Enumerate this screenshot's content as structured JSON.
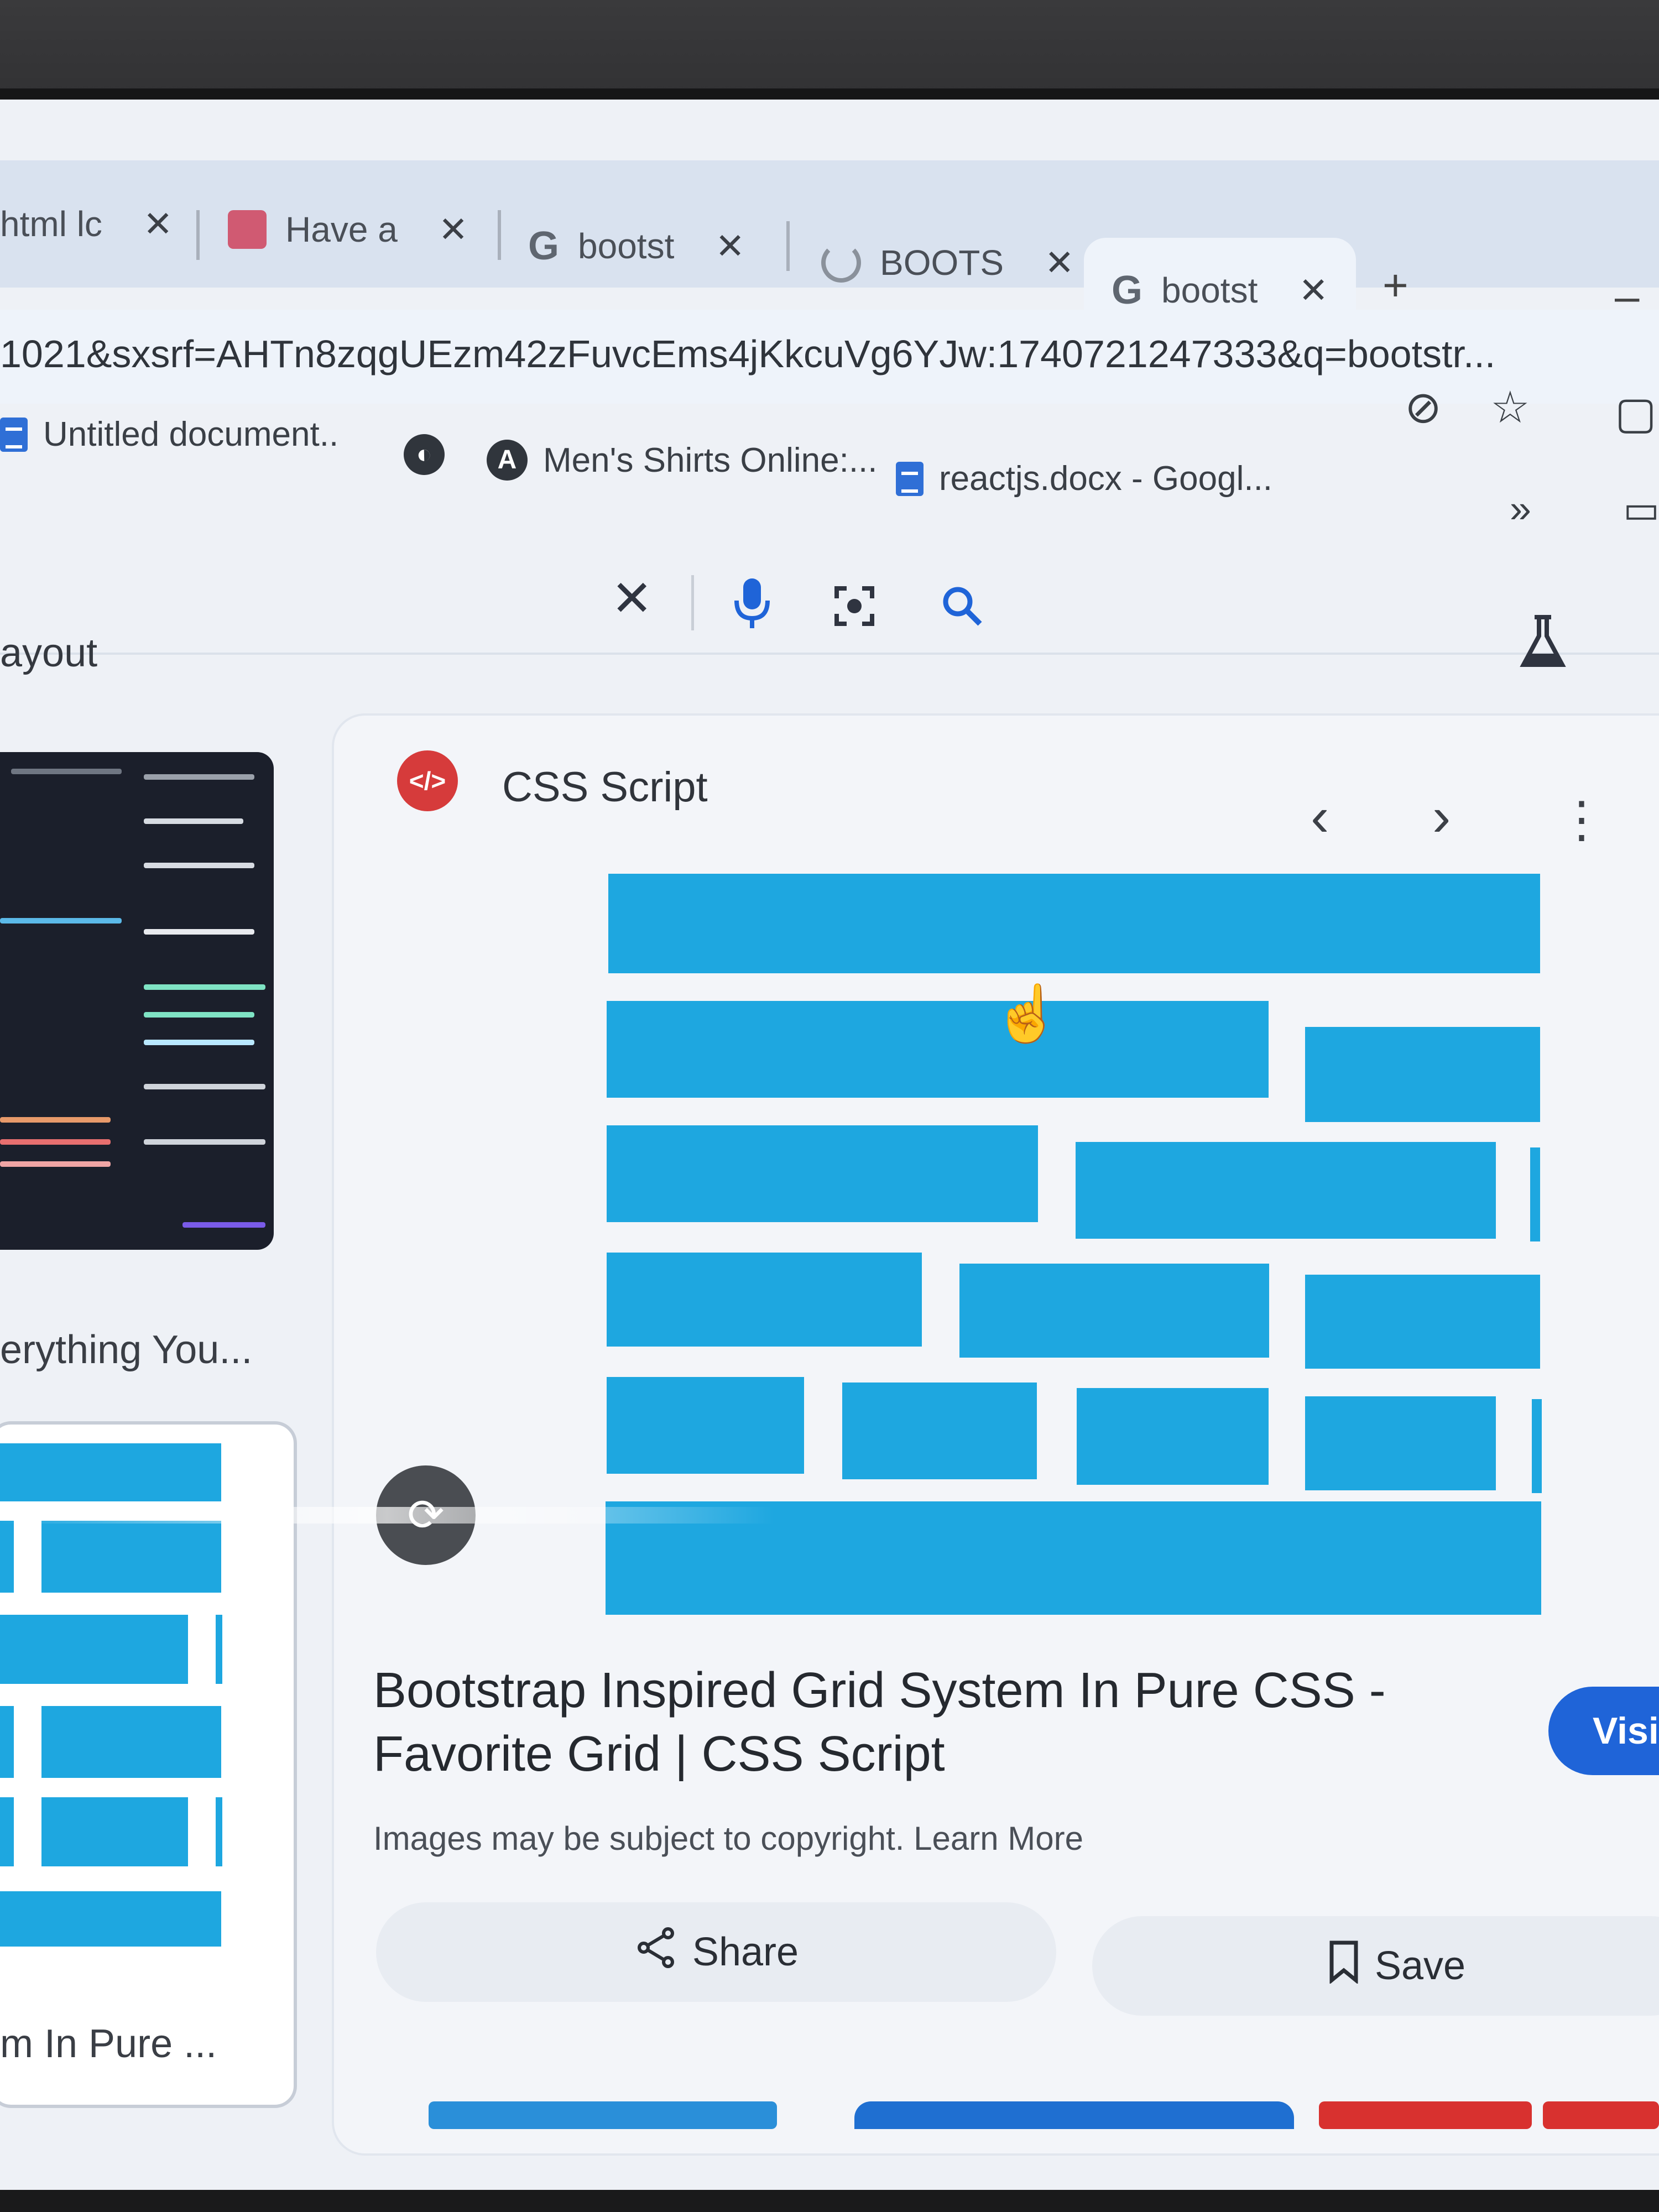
{
  "tabs": [
    {
      "label": "html lc",
      "close": "✕"
    },
    {
      "label": "Have a",
      "close": "✕"
    },
    {
      "label": "bootst",
      "close": "✕"
    },
    {
      "label": "BOOTS",
      "close": "✕"
    },
    {
      "label": "bootst",
      "close": "✕",
      "active": true
    }
  ],
  "new_tab": "+",
  "minimize": "–",
  "address": {
    "url": "1021&sxsrf=AHTn8zqgUEzm42zFuvcEms4jKkcuVg6YJw:1740721247333&q=bootstr..."
  },
  "bookmarks": [
    {
      "label": "Untitled document..",
      "icon": "doc-icon"
    },
    {
      "label": "",
      "icon": "globe-icon"
    },
    {
      "label": "Men's Shirts Online:...",
      "icon": "a-icon"
    },
    {
      "label": "reactjs.docx - Googl...",
      "icon": "doc-icon"
    }
  ],
  "bookmarks_more": "»",
  "search": {
    "query_fragment": "ayout",
    "clear_icon": "✕",
    "mic_icon": "🎤",
    "lens_icon": "lens-icon",
    "search_icon": "search-icon"
  },
  "left_results": [
    {
      "caption": "erything You..."
    },
    {
      "caption": "m In Pure ..."
    }
  ],
  "panel": {
    "source_name": "CSS Script",
    "source_icon_text": "</>",
    "prev": "‹",
    "next": "›",
    "more": "⋮",
    "title": "Bootstrap Inspired Grid System In Pure CSS - Favorite Grid | CSS Script",
    "copyright": "Images may be subject to copyright. Learn More",
    "visit_label": "Visit",
    "share_label": "Share",
    "save_label": "Save"
  },
  "colors": {
    "grid_blue": "#1ea7e0",
    "visit_blue": "#1f64d8",
    "source_red": "#d63b3b"
  }
}
